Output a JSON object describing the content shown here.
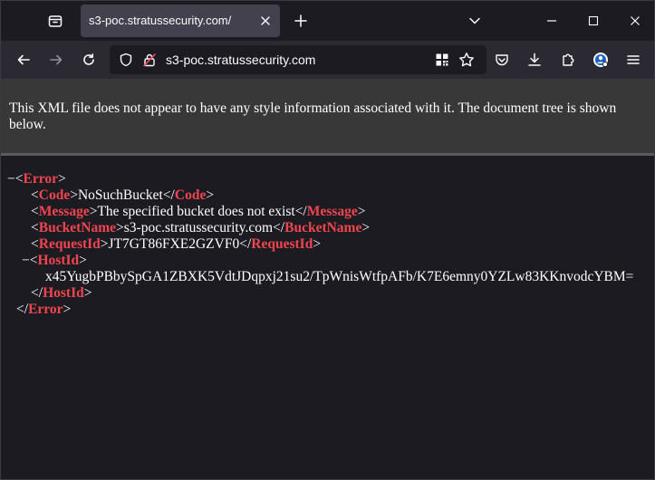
{
  "tab": {
    "title": "s3-poc.stratussecurity.com/"
  },
  "urlbar": {
    "url": "s3-poc.stratussecurity.com"
  },
  "xml_info": {
    "message": "This XML file does not appear to have any style information associated with it. The document tree is shown below."
  },
  "xml_tree": {
    "toggle_symbol": "−",
    "error_tag": "Error",
    "code_tag": "Code",
    "code_value": "NoSuchBucket",
    "message_tag": "Message",
    "message_value": "The specified bucket does not exist",
    "bucketname_tag": "BucketName",
    "bucketname_value": "s3-poc.stratussecurity.com",
    "requestid_tag": "RequestId",
    "requestid_value": "JT7GT86FXE2GZVF0",
    "hostid_tag": "HostId",
    "hostid_value": "x45YugbPBbySpGA1ZBXK5VdtJDqpxj21su2/TpWnisWtfpAFb/K7E6emny0YZLw83KKnvodcYBM="
  },
  "colors": {
    "window_bg": "#1c1b22",
    "toolbar_bg": "#2b2a33",
    "tab_active_bg": "#42414d",
    "info_bar_bg": "#383838",
    "xml_tag_color": "#f0454f",
    "text_color": "#ffffff"
  },
  "icons": {
    "tab_list": "tab-list-icon",
    "tab_close": "close-icon",
    "new_tab": "plus-icon",
    "tab_overflow": "chevron-down-icon",
    "window_minimize": "minimize-icon",
    "window_maximize": "maximize-icon",
    "window_close": "close-icon",
    "back": "back-arrow-icon",
    "forward": "forward-arrow-icon",
    "reload": "reload-icon",
    "tracking_protection": "shield-icon",
    "insecure_lock": "insecure-lock-icon",
    "qr_code": "qr-code-icon",
    "bookmark": "star-icon",
    "pocket": "pocket-icon",
    "downloads": "download-icon",
    "extensions": "puzzle-icon",
    "account": "account-avatar-icon",
    "menu": "hamburger-menu-icon"
  }
}
